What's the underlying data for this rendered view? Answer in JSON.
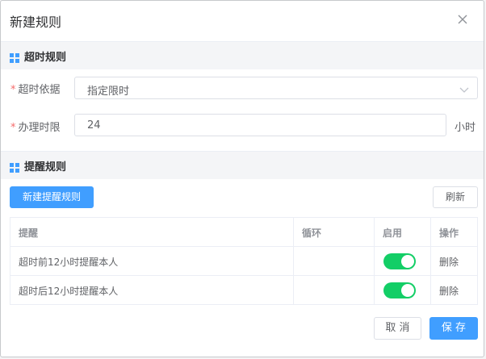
{
  "dialog": {
    "title": "新建规则",
    "close_icon": "close-icon"
  },
  "timeout_section": {
    "title": "超时规则",
    "basis_label": "超时依据",
    "basis_value": "指定限时",
    "limit_label": "办理时限",
    "limit_value": "24",
    "limit_unit": "小时"
  },
  "reminder_section": {
    "title": "提醒规则",
    "new_button": "新建提醒规则",
    "refresh_button": "刷新",
    "table": {
      "headers": [
        "提醒",
        "循环",
        "启用",
        "操作"
      ],
      "rows": [
        {
          "reminder": "超时前12小时提醒本人",
          "loop": "",
          "enabled": true,
          "action": "删除"
        },
        {
          "reminder": "超时后12小时提醒本人",
          "loop": "",
          "enabled": true,
          "action": "删除"
        }
      ]
    }
  },
  "footer": {
    "cancel": "取 消",
    "save": "保 存"
  },
  "colors": {
    "primary": "#409eff",
    "danger": "#f56c6c",
    "switch_on": "#13ce66",
    "required": "#f56c6c"
  }
}
